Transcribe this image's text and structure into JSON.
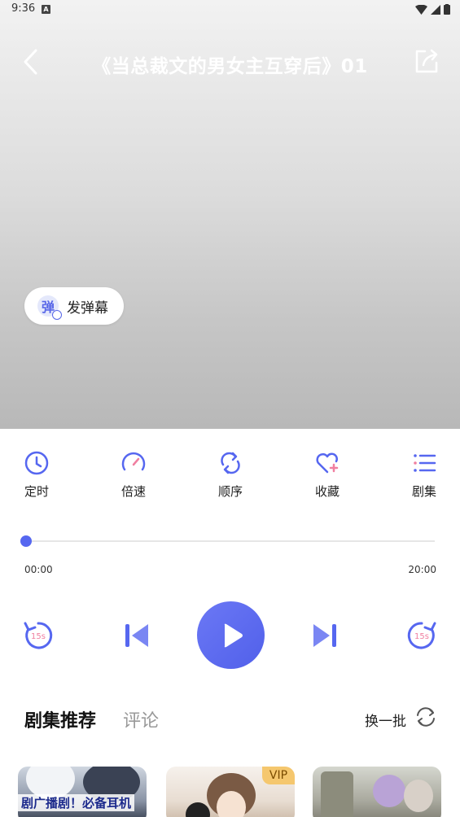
{
  "status_bar": {
    "time": "9:36",
    "notification_icon": "A"
  },
  "header": {
    "title": "《当总裁文的男女主互穿后》01"
  },
  "danmaku": {
    "label": "发弹幕",
    "icon_char": "弹"
  },
  "functions": [
    {
      "label": "定时",
      "icon": "clock-icon"
    },
    {
      "label": "倍速",
      "icon": "speedometer-icon"
    },
    {
      "label": "顺序",
      "icon": "repeat-icon"
    },
    {
      "label": "收藏",
      "icon": "heart-plus-icon"
    },
    {
      "label": "剧集",
      "icon": "list-icon"
    }
  ],
  "player": {
    "current_time": "00:00",
    "total_time": "20:00",
    "progress": 0,
    "rewind_label": "15s",
    "forward_label": "15s"
  },
  "tabs": {
    "active": "剧集推荐",
    "inactive": "评论"
  },
  "refresh": {
    "label": "换一批"
  },
  "cards": [
    {
      "overlay_text": "剧广播剧！必备耳机"
    },
    {
      "badge": "VIP"
    },
    {}
  ],
  "colors": {
    "accent": "#5667f0",
    "vip": "#f5c76e"
  }
}
